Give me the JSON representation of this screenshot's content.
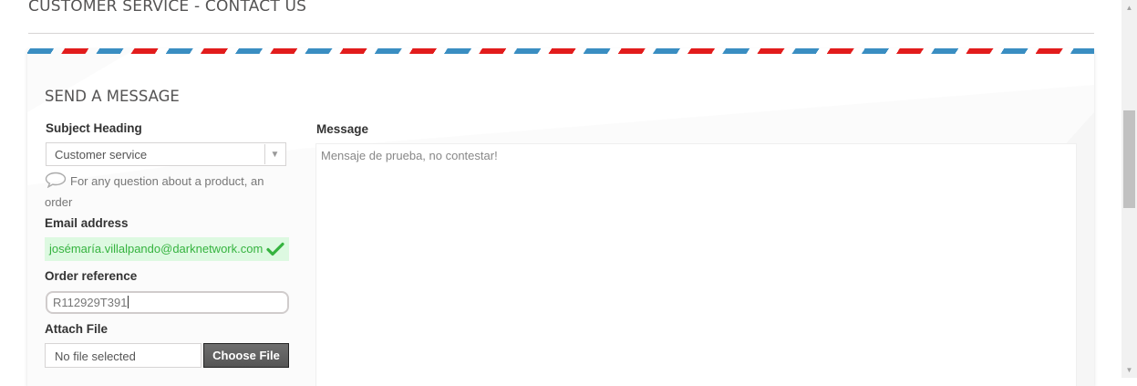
{
  "header": {
    "title": "CUSTOMER SERVICE - CONTACT US"
  },
  "form": {
    "section_title": "SEND A MESSAGE",
    "subject": {
      "label": "Subject Heading",
      "selected": "Customer service",
      "description": "For any question about a product, an order"
    },
    "email": {
      "label": "Email address",
      "value": "josémaría.villalpando@darknetwork.com"
    },
    "order": {
      "label": "Order reference",
      "value": "R112929T391"
    },
    "attach": {
      "label": "Attach File",
      "file_name": "No file selected",
      "button_label": "Choose File"
    },
    "message": {
      "label": "Message",
      "value": "Mensaje de prueba, no contestar!"
    }
  },
  "colors": {
    "stripe_blue": "#3a8ec2",
    "stripe_red": "#e21c1c",
    "valid_green": "#35b33f",
    "valid_bg": "#ddf9e1"
  },
  "icons": [
    "speech-bubble-icon",
    "checkmark-icon",
    "chevron-down-icon"
  ]
}
